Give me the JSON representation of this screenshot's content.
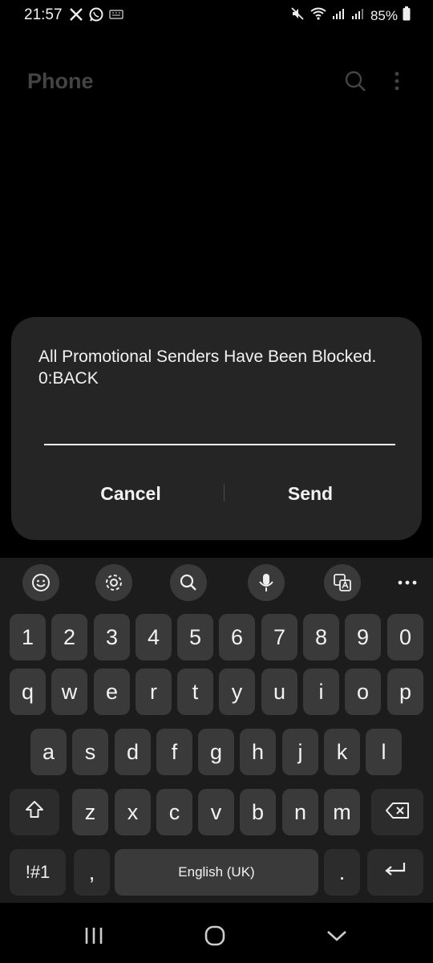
{
  "status_bar": {
    "time": "21:57",
    "left_icons": [
      "x-app-icon",
      "whatsapp-icon",
      "keyboard-notif-icon"
    ],
    "right_icons": [
      "mute-icon",
      "wifi-icon",
      "signal-icon",
      "signal-icon"
    ],
    "battery": "85%"
  },
  "app": {
    "title": "Phone",
    "icons": [
      "search-icon",
      "more-vert-icon"
    ]
  },
  "dialog": {
    "message": "All Promotional Senders Have Been Blocked.\n0:BACK",
    "input_value": "",
    "cancel_label": "Cancel",
    "send_label": "Send"
  },
  "keyboard": {
    "toolbar_icons": [
      "emoji-icon",
      "settings-icon",
      "search-icon",
      "mic-icon",
      "translate-icon",
      "more-horiz-icon"
    ],
    "row1": [
      "1",
      "2",
      "3",
      "4",
      "5",
      "6",
      "7",
      "8",
      "9",
      "0"
    ],
    "row2": [
      "q",
      "w",
      "e",
      "r",
      "t",
      "y",
      "u",
      "i",
      "o",
      "p"
    ],
    "row3": [
      "a",
      "s",
      "d",
      "f",
      "g",
      "h",
      "j",
      "k",
      "l"
    ],
    "row4": [
      "z",
      "x",
      "c",
      "v",
      "b",
      "n",
      "m"
    ],
    "symbols_label": "!#1",
    "comma_label": ",",
    "space_label": "English (UK)",
    "period_label": ".",
    "shift_icon": "shift-icon",
    "backspace_icon": "backspace-icon",
    "enter_icon": "enter-icon"
  },
  "nav_bar": {
    "icons": [
      "recents-icon",
      "home-icon",
      "back-icon"
    ]
  },
  "colors": {
    "background": "#000000",
    "dialog": "#252525",
    "key": "#3a3a3a",
    "keyboard_bg": "#1c1c1c",
    "title_dim": "#444444"
  }
}
